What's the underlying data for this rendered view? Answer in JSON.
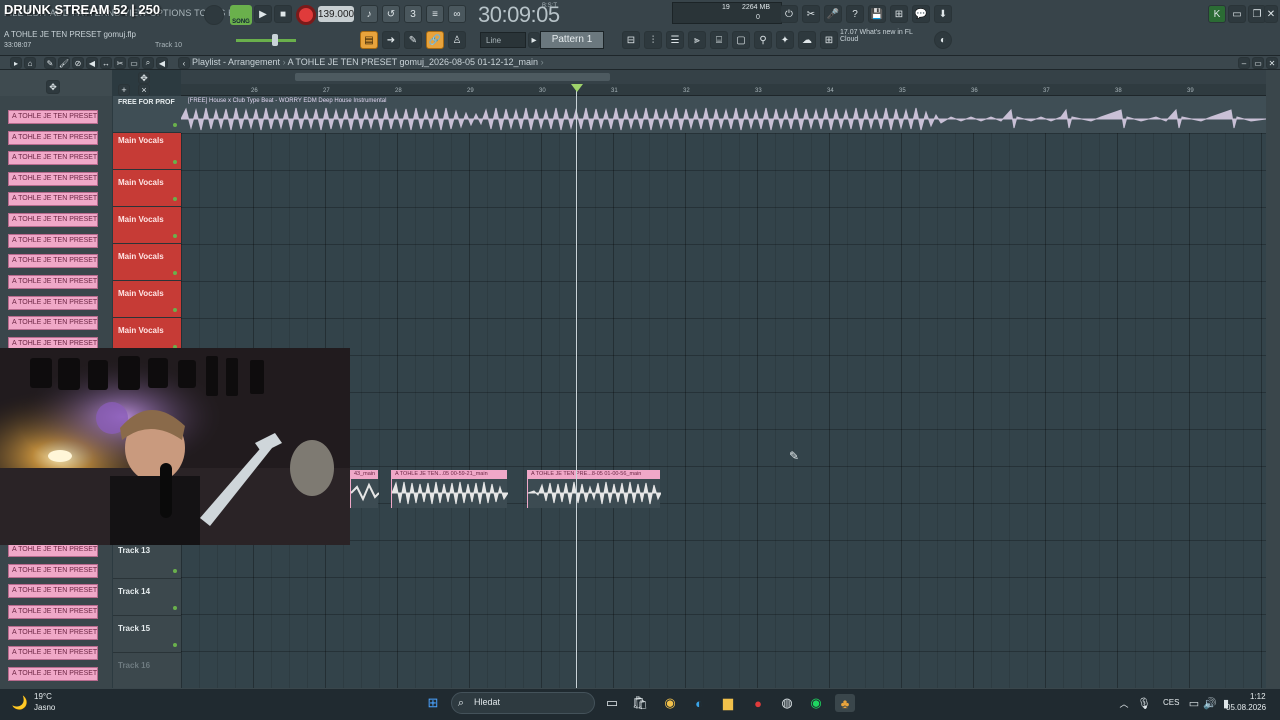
{
  "overlay": {
    "title": "DRUNK STREAM 52 | 250"
  },
  "menu": {
    "text": "FILE  EDIT  ADD  PATTERNS  VIEW  OPTIONS  TOOLS  HELP"
  },
  "project": {
    "file_hint": "A TOHLE JE TEN PRESET gomuj.flp",
    "time": "33:08:07",
    "track_hint": "Track 10"
  },
  "transport": {
    "song_label": "SONG",
    "tempo": "139.000",
    "clock": "30:09:05",
    "clock_sub": "B:S:T"
  },
  "monitor": {
    "cpu": "19",
    "memory": "2264 MB",
    "zero": "0"
  },
  "snap": {
    "line": "Line",
    "pattern": "Pattern 1"
  },
  "news": {
    "line1": "17.07  What's new in FL",
    "line2": "Cloud"
  },
  "playlist": {
    "title": "Playlist - Arrangement",
    "sep": "›",
    "project_name": "A TOHLE JE TEN PRESET gomuj_2026-08-05 01-12-12_main",
    "ruler": [
      "26",
      "27",
      "28",
      "29",
      "30",
      "31",
      "32",
      "33",
      "34",
      "35",
      "36",
      "37",
      "38",
      "39"
    ]
  },
  "clips_panel": {
    "items": [
      "A TOHLE JE TEN PRESET g",
      "A TOHLE JE TEN PRESET g",
      "A TOHLE JE TEN PRESET g",
      "A TOHLE JE TEN PRESET g",
      "A TOHLE JE TEN PRESET g",
      "A TOHLE JE TEN PRESET g",
      "A TOHLE JE TEN PRESET g",
      "A TOHLE JE TEN PRESET g",
      "A TOHLE JE TEN PRESET g",
      "A TOHLE JE TEN PRESET g",
      "A TOHLE JE TEN PRESET g",
      "A TOHLE JE TEN PRESET g",
      "A TOHLE JE TEN PRESET g"
    ],
    "items_bottom": [
      "A TOHLE JE TEN PRESET g",
      "A TOHLE JE TEN PRESET g",
      "A TOHLE JE TEN PRESET g",
      "A TOHLE JE TEN PRESET g",
      "A TOHLE JE TEN PRESET g",
      "A TOHLE JE TEN PRESET g",
      "A TOHLE JE TEN PRESET g"
    ]
  },
  "tracks": {
    "t1": "FREE FOR PROF",
    "t2": "Main Vocals",
    "t3": "Main Vocals",
    "t4": "Main Vocals",
    "t5": "Main Vocals",
    "t6": "Main Vocals",
    "t7": "Main Vocals",
    "t13": "Track 13",
    "t14": "Track 14",
    "t15": "Track 15",
    "t16": "Track 16"
  },
  "arrangement": {
    "beat_clip_label": "[FREE] House x Club Type Beat - WORRY  EDM Deep House Instrumental",
    "clip_a": "43_main",
    "clip_b": "A TOHLE JE TEN...05 00-59-21_main",
    "clip_c": "A TOHLE JE TEN PRE...8-05 01-00-56_main"
  },
  "taskbar": {
    "weather_temp": "19°C",
    "weather_desc": "Jasno",
    "search": "Hledat",
    "language": "CES",
    "time": "1:12",
    "date": "05.08.2026"
  },
  "colors": {
    "accent_green": "#6ab04c",
    "clip_pink": "#f0a8c8",
    "track_red": "#c63b36",
    "record_red": "#e03b3b",
    "orange": "#e8a33c"
  }
}
